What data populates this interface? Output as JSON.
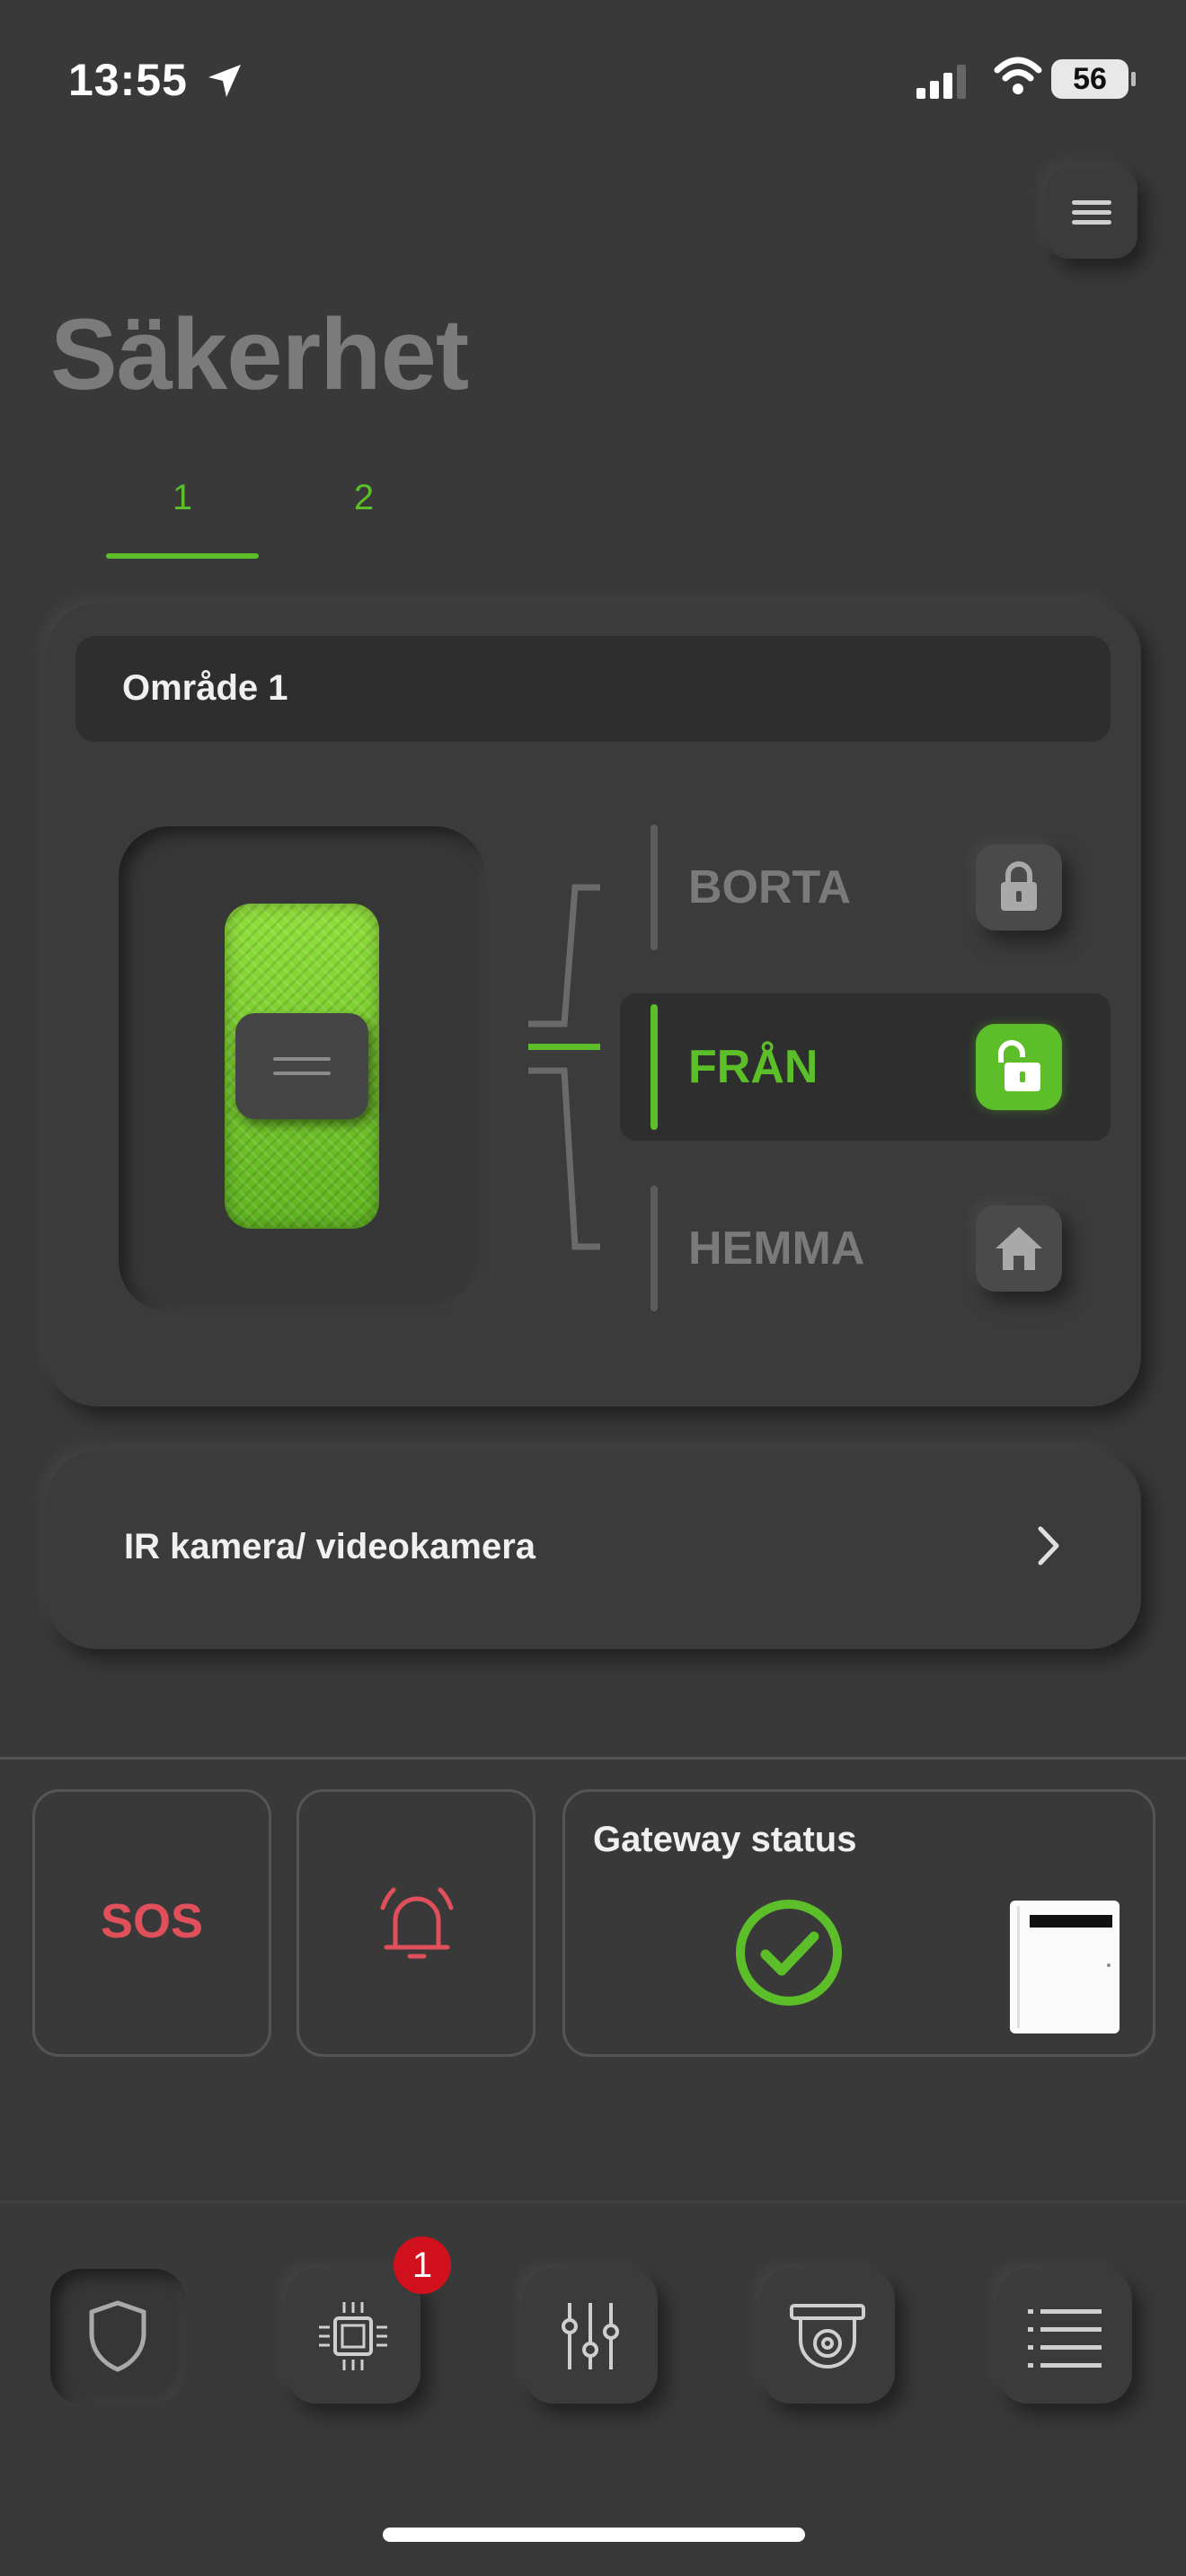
{
  "status_bar": {
    "time": "13:55",
    "battery": "56"
  },
  "header": {
    "title": "Säkerhet"
  },
  "tabs": [
    {
      "label": "1",
      "active": true
    },
    {
      "label": "2",
      "active": false
    }
  ],
  "area": {
    "title": "Område 1",
    "modes": [
      {
        "label": "BORTA",
        "icon": "lock-closed-icon",
        "active": false
      },
      {
        "label": "FRÅN",
        "icon": "lock-open-icon",
        "active": true
      },
      {
        "label": "HEMMA",
        "icon": "home-icon",
        "active": false
      }
    ]
  },
  "camera_row": {
    "label": "IR kamera/ videokamera"
  },
  "quick_actions": {
    "sos_label": "SOS",
    "gateway_title": "Gateway status"
  },
  "bottom_nav": {
    "items": [
      {
        "icon": "shield-icon"
      },
      {
        "icon": "chip-icon",
        "badge": "1"
      },
      {
        "icon": "sliders-icon"
      },
      {
        "icon": "camera-icon"
      },
      {
        "icon": "list-icon"
      }
    ]
  },
  "colors": {
    "accent": "#5cbf2a",
    "alert": "#e0505a",
    "badge": "#d1101e",
    "background": "#393939"
  }
}
